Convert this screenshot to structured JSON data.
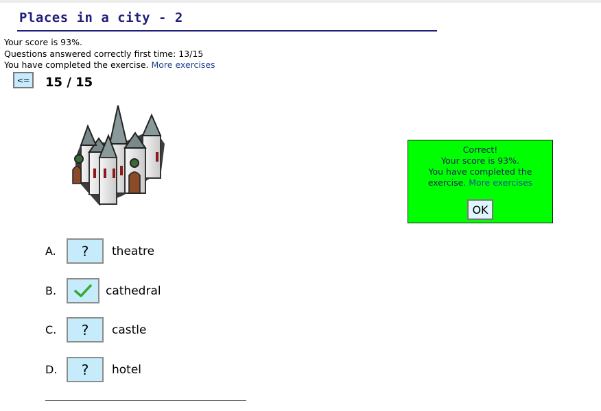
{
  "exercise": {
    "title": "Places in a city - 2"
  },
  "feedback": {
    "score_text": "Your score is 93%.",
    "correct_first_time": "Questions answered correctly first time: 13/15",
    "completed_text": "You have completed the exercise.",
    "more_link": "More exercises"
  },
  "navigation": {
    "back_label": "<=",
    "counter": "15 / 15"
  },
  "question": {
    "image_icon": "cathedral-icon"
  },
  "options": [
    {
      "letter": "A.",
      "mark": "?",
      "text": "theatre",
      "state": "unanswered"
    },
    {
      "letter": "B.",
      "mark": "",
      "text": "cathedral",
      "state": "correct",
      "icon": "checkmark-icon"
    },
    {
      "letter": "C.",
      "mark": "?",
      "text": "castle",
      "state": "unanswered"
    },
    {
      "letter": "D.",
      "mark": "?",
      "text": "hotel",
      "state": "unanswered"
    }
  ],
  "popup": {
    "line1": "Correct!",
    "line2": "Your score is 93%.",
    "line3": "You have completed the",
    "line4_text": "exercise.",
    "line4_link": "More exercises",
    "ok_label": "OK"
  },
  "colors": {
    "title": "#1f1f7a",
    "button_fill": "#c6ecfb",
    "popup_background": "#00ff00",
    "link": "#1f3f8f",
    "check": "#33aa33"
  }
}
